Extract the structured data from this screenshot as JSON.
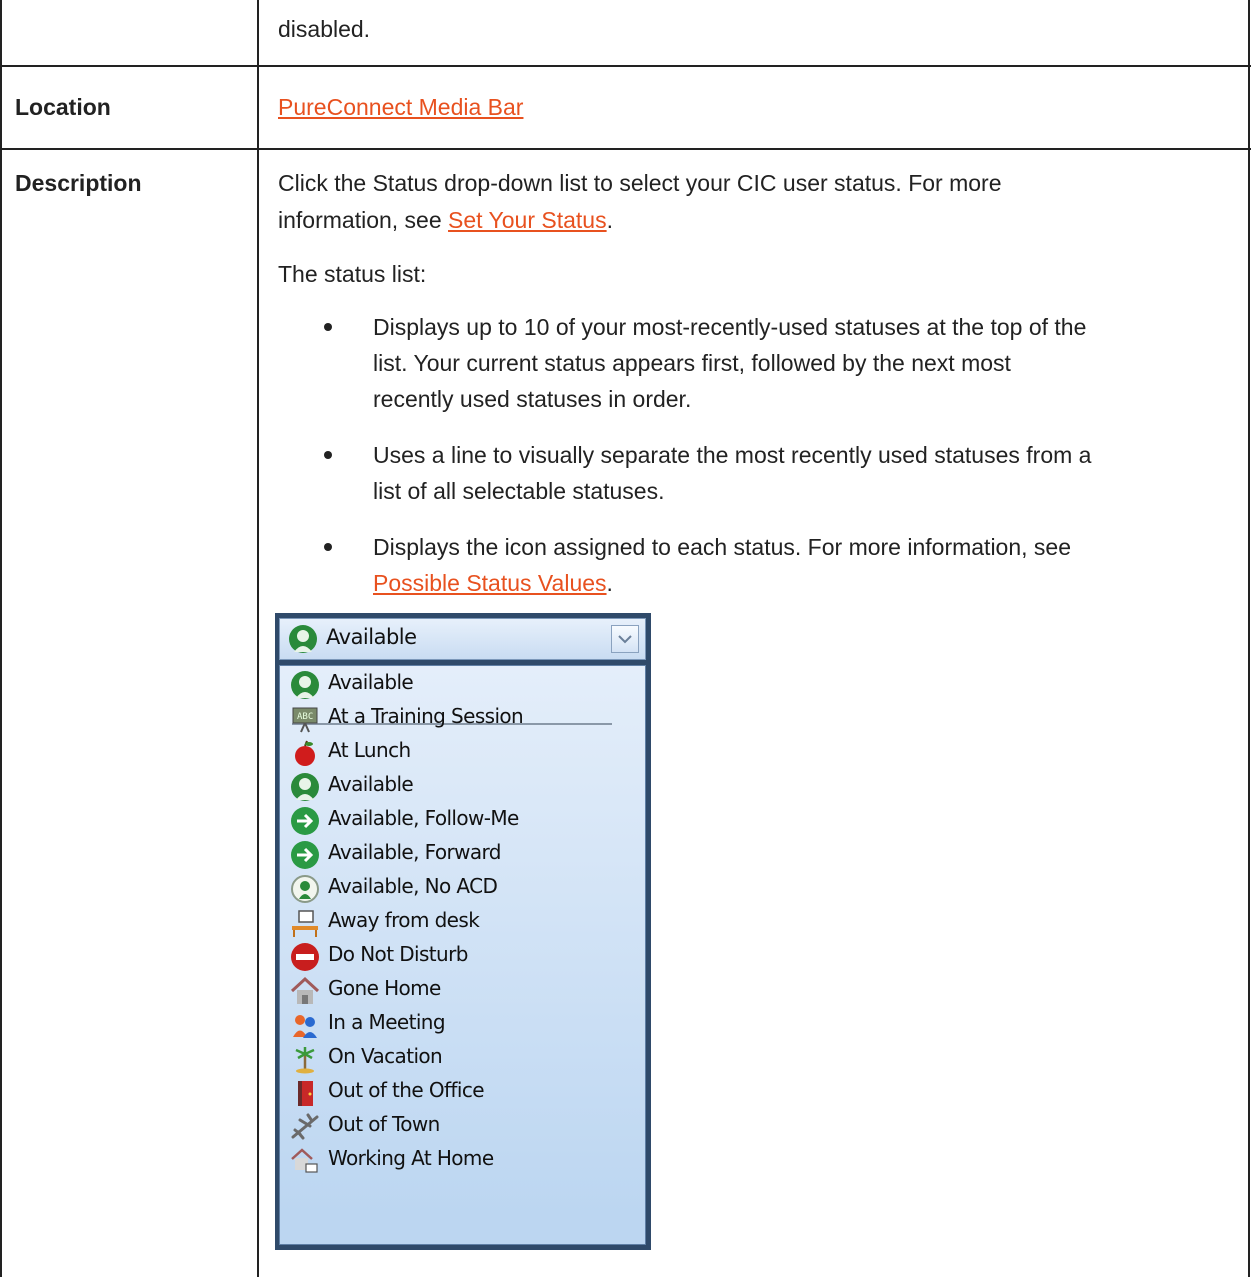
{
  "rows": {
    "continued": {
      "text": "disabled."
    },
    "location": {
      "label": "Location",
      "link": "PureConnect Media Bar"
    },
    "description": {
      "label": "Description",
      "para1_line1": "Click the Status drop-down list to select your CIC user status. For more",
      "para1_line2_prefix": "information, see ",
      "para1_link": "Set Your Status",
      "para1_line2_suffix": ".",
      "para2": "The status list:",
      "bullets": [
        {
          "lines": [
            "Displays up to 10 of your most-recently-used statuses at the top of the",
            "list. Your current status appears first, followed by the next most",
            "recently used statuses in order."
          ]
        },
        {
          "lines": [
            "Uses a line to visually separate the most recently used statuses from a",
            "list of all selectable statuses."
          ]
        },
        {
          "lines": [
            "Displays the icon assigned to each status. For more information, see"
          ],
          "link": "Possible Status Values",
          "link_suffix": "."
        }
      ]
    }
  },
  "status_widget": {
    "selected": "Available",
    "selected_icon": "available-person-icon",
    "items": [
      {
        "label": "Available",
        "icon": "available-person-icon"
      },
      {
        "label": "At a Training Session",
        "icon": "training-icon"
      },
      {
        "label": "At Lunch",
        "icon": "apple-icon"
      },
      {
        "label": "Available",
        "icon": "available-person-icon"
      },
      {
        "label": "Available, Follow-Me",
        "icon": "green-arrow-icon"
      },
      {
        "label": "Available, Forward",
        "icon": "green-arrow-icon"
      },
      {
        "label": "Available, No ACD",
        "icon": "available-no-acd-icon"
      },
      {
        "label": "Away from desk",
        "icon": "desk-icon"
      },
      {
        "label": "Do Not Disturb",
        "icon": "do-not-disturb-icon"
      },
      {
        "label": "Gone Home",
        "icon": "house-icon"
      },
      {
        "label": "In a Meeting",
        "icon": "meeting-icon"
      },
      {
        "label": "On Vacation",
        "icon": "palm-tree-icon"
      },
      {
        "label": "Out of the Office",
        "icon": "door-icon"
      },
      {
        "label": "Out of Town",
        "icon": "airplane-icon"
      },
      {
        "label": "Working At Home",
        "icon": "home-computer-icon"
      }
    ]
  },
  "colors": {
    "link": "#e8511f",
    "border": "#222222",
    "widget_frame": "#2f4a6a"
  }
}
